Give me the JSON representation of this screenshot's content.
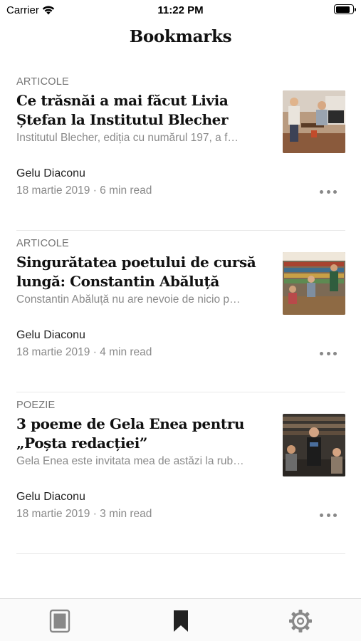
{
  "status_bar": {
    "carrier": "Carrier",
    "time": "11:22 PM",
    "battery_level": 0.85
  },
  "header": {
    "title": "Bookmarks"
  },
  "articles": [
    {
      "category": "ARTICOLE",
      "title": "Ce trăsnăi  a mai făcut Livia Ștefan la Institutul Blecher",
      "excerpt": "Institutul Blecher, ediția cu numărul 197, a f…",
      "author": "Gelu Diaconu",
      "meta": "18 martie 2019 · 6 min read",
      "thumbnail": "event-reading-photo"
    },
    {
      "category": "ARTICOLE",
      "title": "Singurătatea poetului de cursă lungă: Constantin Abăluță",
      "excerpt": "Constantin Abăluță nu are nevoie de nicio p…",
      "author": "Gelu Diaconu",
      "meta": "18 martie 2019 · 4 min read",
      "thumbnail": "bookstore-event-photo"
    },
    {
      "category": "POEZIE",
      "title": "3 poeme de Gela Enea pentru „Poșta redacției”",
      "excerpt": "Gela Enea este invitata mea de astăzi la rub…",
      "author": "Gelu Diaconu",
      "meta": "18 martie 2019 · 3 min read",
      "thumbnail": "poetry-reading-photo"
    }
  ],
  "tabbar": {
    "items": [
      {
        "icon": "feed-icon",
        "active": false
      },
      {
        "icon": "bookmark-icon",
        "active": true
      },
      {
        "icon": "gear-icon",
        "active": false
      }
    ]
  },
  "colors": {
    "accent": "#111111",
    "muted": "#8a8a8a",
    "tab_active": "#222222",
    "tab_inactive": "#888888"
  }
}
